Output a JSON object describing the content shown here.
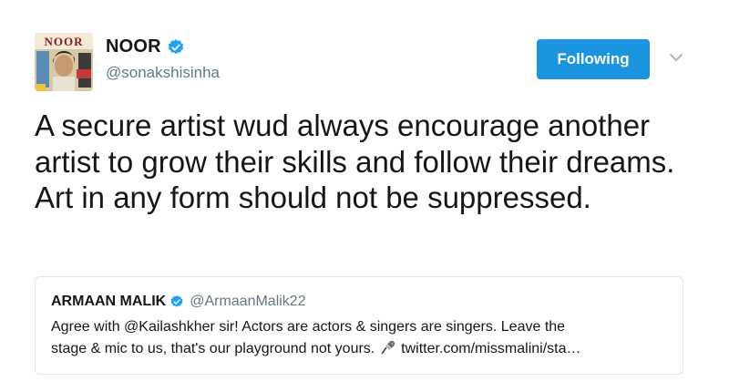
{
  "author": {
    "display_name": "NOOR",
    "handle": "@sonakshisinha",
    "avatar_logo_text": "NOOR",
    "verified": true
  },
  "follow_button": {
    "label": "Following"
  },
  "menu": {
    "icon": "chevron-down-icon"
  },
  "tweet": {
    "text": "A secure artist wud always encourage another artist to grow their skills and follow their dreams. Art in any form should not be suppressed."
  },
  "quoted_tweet": {
    "display_name": "ARMAAN MALIK",
    "handle": "@ArmaanMalik22",
    "verified": true,
    "text_line_1": "Agree with @Kailashkher sir! Actors are actors & singers are singers. Leave the",
    "text_line_2_before_emoji": "stage & mic to us, that's our playground not yours.",
    "emoji": "microphone-icon",
    "text_line_2_link": "twitter.com/missmalini/sta…"
  },
  "colors": {
    "accent": "#1b95e0",
    "text": "#14171a",
    "secondary_text": "#657786",
    "border": "#e1e8ed"
  }
}
